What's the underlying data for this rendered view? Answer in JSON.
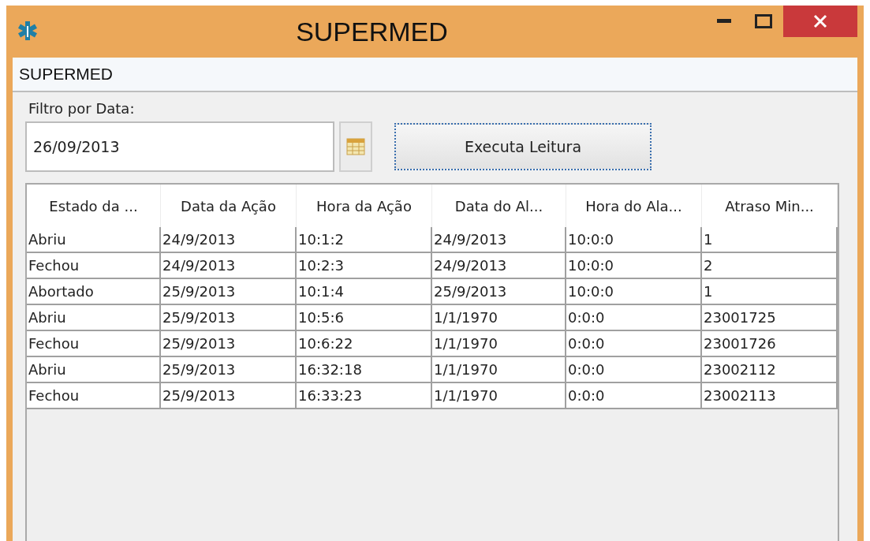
{
  "window": {
    "title": "SUPERMED"
  },
  "menu": {
    "label": "SUPERMED"
  },
  "filter": {
    "label": "Filtro por Data:",
    "value": "26/09/2013"
  },
  "button": {
    "label": "Executa Leitura"
  },
  "table": {
    "columns": [
      "Estado da ...",
      "Data da Ação",
      "Hora da Ação",
      "Data do Al...",
      "Hora do Ala...",
      "Atraso Min..."
    ],
    "rows": [
      [
        "Abriu",
        "24/9/2013",
        "10:1:2",
        "24/9/2013",
        "10:0:0",
        "1"
      ],
      [
        "Fechou",
        "24/9/2013",
        "10:2:3",
        "24/9/2013",
        "10:0:0",
        "2"
      ],
      [
        "Abortado",
        "25/9/2013",
        "10:1:4",
        "25/9/2013",
        "10:0:0",
        "1"
      ],
      [
        "Abriu",
        "25/9/2013",
        "10:5:6",
        "1/1/1970",
        "0:0:0",
        "23001725"
      ],
      [
        "Fechou",
        "25/9/2013",
        "10:6:22",
        "1/1/1970",
        "0:0:0",
        "23001726"
      ],
      [
        "Abriu",
        "25/9/2013",
        "16:32:18",
        "1/1/1970",
        "0:0:0",
        "23002112"
      ],
      [
        "Fechou",
        "25/9/2013",
        "16:33:23",
        "1/1/1970",
        "0:0:0",
        "23002113"
      ]
    ]
  }
}
